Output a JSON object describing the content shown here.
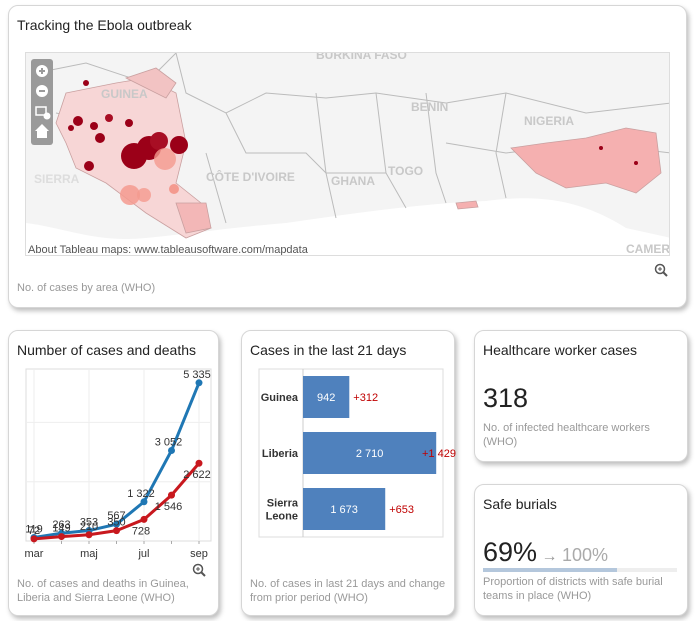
{
  "map_card": {
    "title": "Tracking the Ebola outbreak",
    "caption": "No. of cases by area (WHO)",
    "attribution": "About Tableau maps: www.tableausoftware.com/mapdata",
    "country_labels": [
      "BURKINA FASO",
      "GUINEA",
      "SIERRA",
      "CÔTE D'IVOIRE",
      "GHANA",
      "TOGO",
      "BENIN",
      "NIGERIA",
      "CAMER"
    ],
    "controls": [
      "zoom-in-icon",
      "zoom-out-icon",
      "select-area-icon",
      "home-icon"
    ],
    "zoom_icon": "magnifier-plus-icon"
  },
  "line_card": {
    "title": "Number of cases and deaths",
    "caption": "No. of cases and deaths in Guinea, Liberia and Sierra Leone (WHO)",
    "zoom_icon": "magnifier-plus-icon",
    "chart_data": {
      "type": "line",
      "x": [
        "mar",
        "apr",
        "maj",
        "jun",
        "jul",
        "aug",
        "sep"
      ],
      "xtick_labels": [
        "mar",
        "maj",
        "jul",
        "sep"
      ],
      "ylim": [
        0,
        5800
      ],
      "grid": true,
      "series": [
        {
          "values": [
            119,
            263,
            353,
            567,
            1322,
            3052,
            5335
          ],
          "color": "#1f77b4"
        },
        {
          "values": [
            72,
            149,
            210,
            350,
            728,
            1546,
            2622
          ],
          "color": "#c8181e"
        }
      ]
    }
  },
  "bar_card": {
    "title": "Cases in the last 21 days",
    "caption": "No. of cases in last 21 days and change from prior period (WHO)",
    "chart_data": {
      "type": "bar",
      "orientation": "horizontal",
      "categories": [
        "Guinea",
        "Liberia",
        "Sierra Leone"
      ],
      "values": [
        942,
        2710,
        1673
      ],
      "value_labels": [
        "942",
        "2 710",
        "1 673"
      ],
      "change_labels": [
        "+312",
        "+1 429",
        "+653"
      ],
      "changes": [
        312,
        1429,
        653
      ],
      "xlim": [
        0,
        2950
      ],
      "bar_color": "#4f81bd",
      "change_color": "#c00000"
    }
  },
  "hcw_card": {
    "title": "Healthcare worker cases",
    "value": "318",
    "caption": "No. of infected healthcare workers (WHO)"
  },
  "burial_card": {
    "title": "Safe burials",
    "value": "69%",
    "arrow": "→",
    "target": "100%",
    "progress": 0.69,
    "caption": "Proportion of districts with safe burial teams in place (WHO)"
  }
}
